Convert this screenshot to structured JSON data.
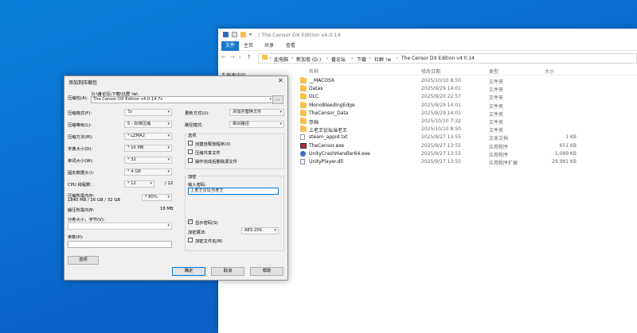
{
  "explorer": {
    "title": "| The Censor DX Edition v4.0.14",
    "ribbon_tabs": [
      "文件",
      "主页",
      "共享",
      "查看"
    ],
    "address": [
      "此电脑",
      "新加卷 (D:)",
      "番论坛",
      "下载",
      "社群 !w",
      "The Censor DX Edition v4.0.14"
    ],
    "nav_item": "快速访问",
    "columns": {
      "name": "名称",
      "date": "修改日期",
      "type": "类型",
      "size": "大小"
    },
    "files": [
      {
        "name": "__MACOSX",
        "date": "2025/10/10 8:50",
        "type": "文件夹",
        "size": "",
        "icon": "folder"
      },
      {
        "name": "Datas",
        "date": "2025/9/29 14:01",
        "type": "文件夹",
        "size": "",
        "icon": "folder"
      },
      {
        "name": "DLC",
        "date": "2025/9/20 22:57",
        "type": "文件夹",
        "size": "",
        "icon": "folder"
      },
      {
        "name": "MonoBleedingEdge",
        "date": "2025/9/29 14:01",
        "type": "文件夹",
        "size": "",
        "icon": "folder"
      },
      {
        "name": "TheCensor_Data",
        "date": "2025/9/29 14:01",
        "type": "文件夹",
        "size": "",
        "icon": "folder"
      },
      {
        "name": "存档",
        "date": "2025/10/10 7:32",
        "type": "文件夹",
        "size": "",
        "icon": "folder"
      },
      {
        "name": "上老王论坛当老王",
        "date": "2025/10/10 8:50",
        "type": "文件夹",
        "size": "",
        "icon": "folder"
      },
      {
        "name": "steam_appid.txt",
        "date": "2025/9/27 13:55",
        "type": "文本文档",
        "size": "1 KB",
        "icon": "txt"
      },
      {
        "name": "TheCensor.exe",
        "date": "2025/9/27 13:55",
        "type": "应用程序",
        "size": "651 KB",
        "icon": "exe"
      },
      {
        "name": "UnityCrashHandler64.exe",
        "date": "2025/9/27 13:55",
        "type": "应用程序",
        "size": "1,089 KB",
        "icon": "gear"
      },
      {
        "name": "UnityPlayer.dll",
        "date": "2025/9/27 13:55",
        "type": "应用程序扩展",
        "size": "29,981 KB",
        "icon": "dll"
      }
    ]
  },
  "dialog": {
    "title": "添加到压缩包",
    "close": "✕",
    "archive_label": "压缩包(A):",
    "archive_path": "D:\\番论坛\\下载\\社群 !w\\",
    "archive_name": "The Censor DX Edition v4.0.14.7z",
    "browse": "...",
    "format_label": "压缩格式(F):",
    "format": "7z",
    "level_label": "压缩等级(L):",
    "level": "5 - 标准压缩",
    "method_label": "压缩方法(M):",
    "method": "* LZMA2",
    "dict_label": "字典大小(D):",
    "dict": "* 16 MB",
    "word_label": "单词大小(W):",
    "word": "* 32",
    "solid_label": "固实数据大小:",
    "solid": "* 4 GB",
    "cpu_label": "CPU 线程数:",
    "cpu": "* 12",
    "cpu_total": "/ 12",
    "mem_label": "压缩所需内存:",
    "mem_detail": "1840 MB / 26 GB / 32 GB",
    "mem_pct": "* 80%",
    "decomp_label": "解压所需内存:",
    "decomp_value": "18 MB",
    "split_label": "分卷大小，字节(V):",
    "params_label": "参数(P):",
    "options_button": "选项",
    "update_label": "更新方式(U):",
    "update": "添加并替换文件",
    "path_label": "路径模式:",
    "path_mode": "相对路径",
    "options_group": "选项",
    "opt1": "创建自释放程序(X)",
    "opt2": "压缩共享文件",
    "opt3": "操作完成后删除源文件",
    "enc_group": "加密",
    "pwd_label": "输入密码:",
    "pwd_value": "上老王论坛当老王",
    "show_pwd": "显示密码(S)",
    "show_pwd_check": "✓",
    "enc_method_label": "加密算法:",
    "enc_method": "AES-256",
    "enc_names": "加密文件名(N)",
    "ok": "确定",
    "cancel": "取消",
    "help": "帮助"
  }
}
